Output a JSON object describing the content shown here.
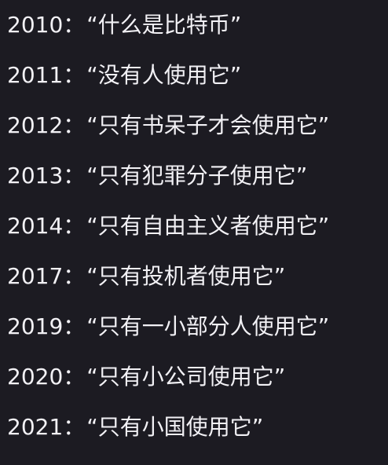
{
  "lines": [
    {
      "year": "2010",
      "sep": "：",
      "quote": "“什么是比特币”"
    },
    {
      "year": "2011",
      "sep": "：",
      "quote": "“没有人使用它”"
    },
    {
      "year": "2012",
      "sep": "：",
      "quote": "“只有书呆子才会使用它”"
    },
    {
      "year": "2013",
      "sep": "：",
      "quote": "“只有犯罪分子使用它”"
    },
    {
      "year": "2014",
      "sep": "：",
      "quote": "“只有自由主义者使用它”"
    },
    {
      "year": "2017",
      "sep": "：",
      "quote": "“只有投机者使用它”"
    },
    {
      "year": "2019",
      "sep": "：",
      "quote": "“只有一小部分人使用它”"
    },
    {
      "year": "2020",
      "sep": "：",
      "quote": "“只有小公司使用它”"
    },
    {
      "year": "2021",
      "sep": "：",
      "quote": "“只有小国使用它”"
    }
  ],
  "colors": {
    "background": "#1c1b22",
    "text": "#f2f1f5"
  }
}
